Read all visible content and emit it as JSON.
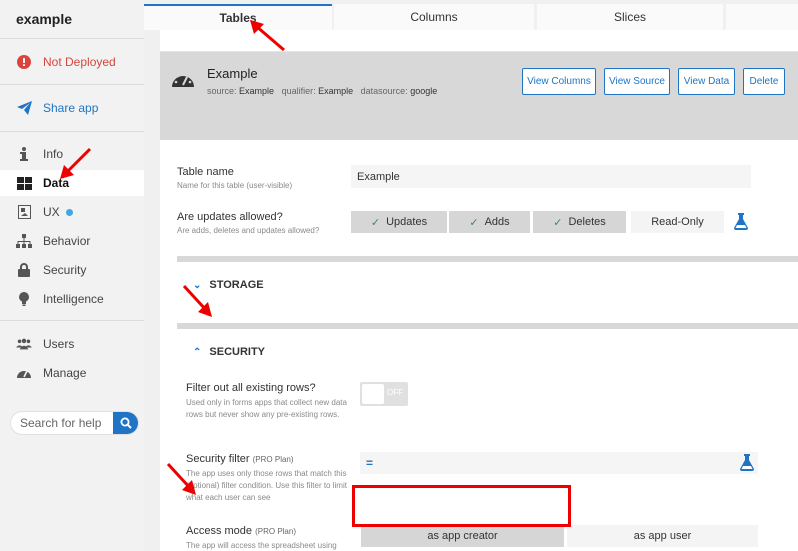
{
  "sidebar": {
    "app_name": "example",
    "status": "Not Deployed",
    "share": "Share app",
    "items": [
      {
        "label": "Info"
      },
      {
        "label": "Data"
      },
      {
        "label": "UX"
      },
      {
        "label": "Behavior"
      },
      {
        "label": "Security"
      },
      {
        "label": "Intelligence"
      }
    ],
    "items2": [
      {
        "label": "Users"
      },
      {
        "label": "Manage"
      }
    ],
    "search_placeholder": "Search for help"
  },
  "tabs": [
    {
      "label": "Tables",
      "active": true
    },
    {
      "label": "Columns"
    },
    {
      "label": "Slices"
    }
  ],
  "table": {
    "name": "Example",
    "source_label": "source:",
    "source": "Example",
    "qualifier_label": "qualifier:",
    "qualifier": "Example",
    "datasource_label": "datasource:",
    "datasource": "google",
    "buttons": {
      "view_columns": "View Columns",
      "view_source": "View Source",
      "view_data": "View Data",
      "delete": "Delete"
    }
  },
  "form": {
    "table_name_label": "Table name",
    "table_name_help": "Name for this table (user-visible)",
    "table_name_value": "Example",
    "updates_label": "Are updates allowed?",
    "updates_help": "Are adds, deletes and updates allowed?",
    "updates_options": {
      "updates": "Updates",
      "adds": "Adds",
      "deletes": "Deletes",
      "read_only": "Read-Only"
    }
  },
  "storage": {
    "title": "STORAGE"
  },
  "security": {
    "title": "SECURITY",
    "filter_rows_label": "Filter out all existing rows?",
    "filter_rows_help": "Used only in forms apps that collect new data rows but never show any pre-existing rows.",
    "toggle_off": "OFF",
    "security_filter_label": "Security filter",
    "security_filter_plan": "(PRO Plan)",
    "security_filter_help": "The app uses only those rows that match this (optional) filter condition. Use this filter to limit what each user can see",
    "access_mode_label": "Access mode",
    "access_mode_plan": "(PRO Plan)",
    "access_mode_help": "The app will access the spreadsheet using the app creator or app user credentials.",
    "access_options": {
      "creator": "as app creator",
      "user": "as app user"
    }
  },
  "colors": {
    "accent": "#1f74c5",
    "status_red": "#d9453d",
    "annotation_red": "#e00000"
  }
}
